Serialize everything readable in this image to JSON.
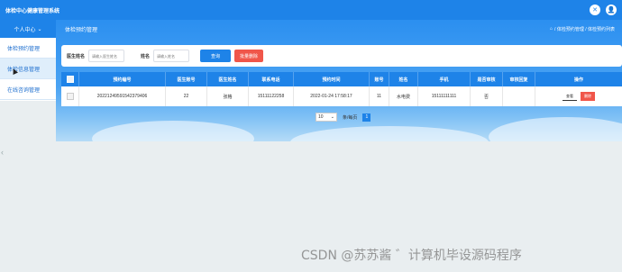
{
  "app": {
    "title": "体检中心健康管理系统"
  },
  "sidebar": {
    "user_center": "个人中心",
    "items": [
      {
        "label": "体检预约管理"
      },
      {
        "label": "体检信息管理"
      },
      {
        "label": "在线咨询管理"
      }
    ]
  },
  "main": {
    "title": "体检预约管理",
    "breadcrumb": "/ 体检预约管理 / 体检预约列表"
  },
  "search": {
    "field1_label": "医生姓名",
    "field1_placeholder": "请输入医生姓名",
    "field2_label": "姓名",
    "field2_placeholder": "请输入姓名",
    "query_button": "查询",
    "batch_delete_button": "批量删除"
  },
  "table": {
    "columns": [
      "预约编号",
      "医生账号",
      "医生姓名",
      "联系电话",
      "预约时间",
      "账号",
      "姓名",
      "手机",
      "是否审核",
      "审核回复",
      "操作"
    ],
    "rows": [
      {
        "id": "20221249591542379406",
        "doctor_account": "22",
        "doctor_name": "张格",
        "phone": "15111122258",
        "time": "2022-01-24 17:58:17",
        "account": "11",
        "name": "水电费",
        "mobile": "15111111111",
        "reviewed": "否",
        "reply": "",
        "view_label": "查看",
        "delete_label": "删除"
      }
    ]
  },
  "pager": {
    "page_size": "10",
    "per_page_label": "条/每页",
    "current_page": "1"
  },
  "watermark": "CSDN @苏苏酱   ゛计算机毕设源码程序"
}
